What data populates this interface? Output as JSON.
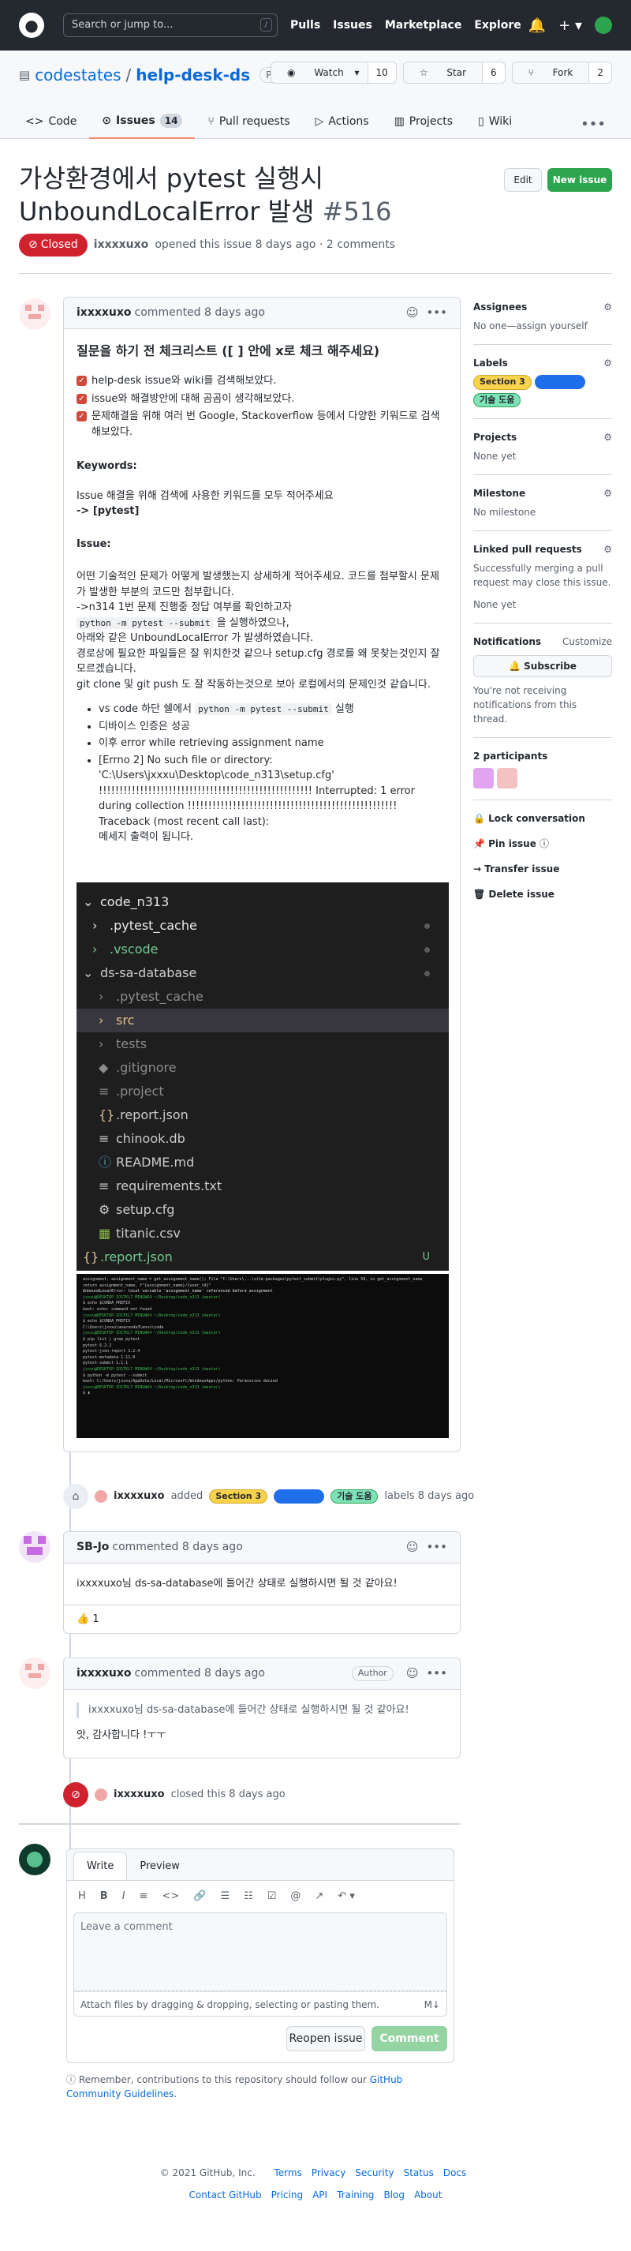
{
  "header": {
    "search_placeholder": "Search or jump to...",
    "slash": "/",
    "nav": [
      "Pulls",
      "Issues",
      "Marketplace",
      "Explore"
    ],
    "plus": "+ ▾"
  },
  "repo": {
    "owner": "codestates",
    "sep": "/",
    "name": "help-desk-ds",
    "visibility": "Private",
    "watch": "Watch",
    "watch_count": "10",
    "star": "Star",
    "star_count": "6",
    "fork": "Fork",
    "fork_count": "2"
  },
  "tabs": [
    {
      "label": "Code",
      "icon": "code-icon"
    },
    {
      "label": "Issues",
      "count": "14",
      "icon": "issue-icon"
    },
    {
      "label": "Pull requests",
      "icon": "pr-icon"
    },
    {
      "label": "Actions",
      "icon": "actions-icon"
    },
    {
      "label": "Projects",
      "icon": "projects-icon"
    },
    {
      "label": "Wiki",
      "icon": "wiki-icon"
    }
  ],
  "issue": {
    "title": "가상환경에서 pytest 실행시 UnboundLocalError 발생",
    "number": "#516",
    "state": "Closed",
    "meta_author": "ixxxxuxo",
    "meta_rest": "opened this issue 8 days ago · 2 comments",
    "edit": "Edit",
    "new_issue": "New issue"
  },
  "c1": {
    "author": "ixxxxuxo",
    "time": "commented 8 days ago",
    "heading": "질문을 하기 전 체크리스트 ([ ] 안에 x로 체크 해주세요)",
    "checks": [
      "help-desk issue와 wiki를 검색해보았다.",
      "issue와 해결방안에 대해 곰곰이 생각해보았다.",
      "문제해결을 위해 여러 번 Google, Stackoverflow 등에서 다양한 키워드로 검색해보았다."
    ],
    "kw_h": "Keywords:",
    "kw_1": "Issue 해결을 위해 검색에 사용한 키워드를 모두 적어주세요",
    "kw_2": "-> [pytest]",
    "is_h": "Issue:",
    "is_1": "어떤 기술적인 문제가 어떻게 발생했는지 상세하게 적어주세요. 코드를 첨부할시 문제가 발생한 부분의 코드만 첨부합니다.",
    "is_2": "->n314 1번 문제 진행중 정답 여부를 확인하고자",
    "is_3a": "python -m pytest --submit",
    "is_3b": "을 실행하였으나,",
    "is_4": "아래와 같은 UnboundLocalError 가 발생하였습니다.",
    "is_5": "경로상에 필요한 파일들은 잘 위치한것 같으나 setup.cfg 경로를 왜 못찾는것인지 잘 모르겠습니다.",
    "is_6": "git clone 및 git push 도 잘 작동하는것으로 보아 로컬에서의 문제인것 같습니다.",
    "b1a": "vs code 하단 쉘에서",
    "b1b": "python -m pytest --submit",
    "b1c": "실행",
    "b2": "디바이스 인증은 성공",
    "b3": "이후 error while retrieving assignment name",
    "b4": "[Errno 2] No such file or directory: 'C:\\Users\\jxxxu\\Desktop\\code_n313\\setup.cfg' !!!!!!!!!!!!!!!!!!!!!!!!!!!!!!!!!!!!!!!!!!!!!!!!!!!! Interrupted: 1 error during collection !!!!!!!!!!!!!!!!!!!!!!!!!!!!!!!!!!!!!!!!!!!!!!!!!!!",
    "b4b": "Traceback (most recent call last):",
    "b4c": "메세지 출력이 됩니다."
  },
  "explorer": [
    {
      "t": "code_n313",
      "ic": "⌄",
      "c": "#e8e8e8"
    },
    {
      "t": ".pytest_cache",
      "ic": "›",
      "c": "#e8e8e8"
    },
    {
      "t": ".vscode",
      "ic": "›",
      "c": "#73c991"
    },
    {
      "t": "ds-sa-database",
      "ic": "⌄",
      "c": "#ccc"
    },
    {
      "t": ".pytest_cache",
      "ic": "›",
      "c": "#8b8b8b"
    },
    {
      "t": "src",
      "ic": "›",
      "c": "#e2c08d"
    },
    {
      "t": "tests",
      "ic": "›",
      "c": "#8b8b8b"
    },
    {
      "t": ".gitignore",
      "ic": "◆",
      "c": "#8b8b8b"
    },
    {
      "t": ".project",
      "ic": "≡",
      "c": "#8b8b8b"
    },
    {
      "t": ".report.json",
      "ic": "{}",
      "c": "#ccc"
    },
    {
      "t": "chinook.db",
      "ic": "≡",
      "c": "#ccc"
    },
    {
      "t": "README.md",
      "ic": "ⓘ",
      "c": "#ccc"
    },
    {
      "t": "requirements.txt",
      "ic": "≡",
      "c": "#ccc"
    },
    {
      "t": "setup.cfg",
      "ic": "⚙",
      "c": "#ccc"
    },
    {
      "t": "titanic.csv",
      "ic": "▦",
      "c": "#ccc"
    },
    {
      "t": ".report.json",
      "ic": "{}",
      "c": "#73c991"
    }
  ],
  "explorer_badge": "U",
  "event1": {
    "author": "ixxxxuxo",
    "pre": "added",
    "post": "labels 8 days ago"
  },
  "labels": [
    {
      "name": "Section 3",
      "bg": "#f9d34c",
      "fg": "#24292f"
    },
    {
      "name": "",
      "bg": "#1f6feb",
      "fg": "#fff"
    },
    {
      "name": "기술 도움",
      "bg": "#7ee2b8",
      "fg": "#24292f"
    }
  ],
  "c2": {
    "author": "SB-Jo",
    "time": "commented 8 days ago",
    "text": "ixxxxuxo님 ds-sa-database에 들어간 상태로 실행하시면 될 것 같아요!",
    "react": "👍 1"
  },
  "c3": {
    "author": "ixxxxuxo",
    "time": "commented 8 days ago",
    "badge": "Author",
    "quote": "ixxxxuxo님 ds-sa-database에 들어간 상태로 실행하시면 될 것 같아요!",
    "text": "앗, 감사합니다 !ㅜㅜ"
  },
  "event2": {
    "author": "ixxxxuxo",
    "text": "closed this 8 days ago"
  },
  "editor": {
    "write": "Write",
    "preview": "Preview",
    "placeholder": "Leave a comment",
    "attach": "Attach files by dragging & dropping, selecting or pasting them.",
    "reopen": "Reopen issue",
    "comment": "Comment",
    "tools": [
      "H",
      "B",
      "I",
      "≡",
      "<>",
      "🔗",
      "☰",
      "☷",
      "☑",
      "@",
      "↗",
      "↶ ▾"
    ]
  },
  "remember": {
    "pre": "Remember, contributions to this repository should follow our",
    "link": "GitHub Community Guidelines",
    "post": "."
  },
  "sidebar": {
    "assignees_h": "Assignees",
    "assignees_v": "No one—assign yourself",
    "labels_h": "Labels",
    "projects_h": "Projects",
    "projects_v": "None yet",
    "milestone_h": "Milestone",
    "milestone_v": "No milestone",
    "linked_h": "Linked pull requests",
    "linked_v": "Successfully merging a pull request may close this issue.",
    "linked_v2": "None yet",
    "notif_h": "Notifications",
    "customize": "Customize",
    "subscribe": "Subscribe",
    "notif_v": "You're not receiving notifications from this thread.",
    "participants": "2 participants",
    "lock": "Lock conversation",
    "pin": "Pin issue",
    "transfer": "Transfer issue",
    "delete": "Delete issue"
  },
  "footer": {
    "copy": "© 2021 GitHub, Inc.",
    "links1": [
      "Terms",
      "Privacy",
      "Security",
      "Status",
      "Docs"
    ],
    "links2": [
      "Contact GitHub",
      "Pricing",
      "API",
      "Training",
      "Blog",
      "About"
    ]
  }
}
